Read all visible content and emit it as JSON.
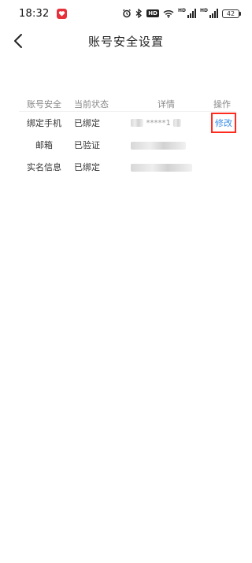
{
  "status_bar": {
    "time": "18:32",
    "battery": "42",
    "hd_label": "HD",
    "signal_tag_1": "HD",
    "signal_tag_2": "HD"
  },
  "header": {
    "title": "账号安全设置"
  },
  "table": {
    "columns": [
      "账号安全",
      "当前状态",
      "详情",
      "操作"
    ],
    "rows": [
      {
        "item": "绑定手机",
        "status": "已绑定",
        "detail": "*****1",
        "action": "修改"
      },
      {
        "item": "邮箱",
        "status": "已验证",
        "detail": "",
        "action": ""
      },
      {
        "item": "实名信息",
        "status": "已绑定",
        "detail": "",
        "action": ""
      }
    ]
  },
  "colors": {
    "link": "#3a8ee6",
    "highlight_border": "#ff2b1e",
    "header_text": "#888888"
  }
}
